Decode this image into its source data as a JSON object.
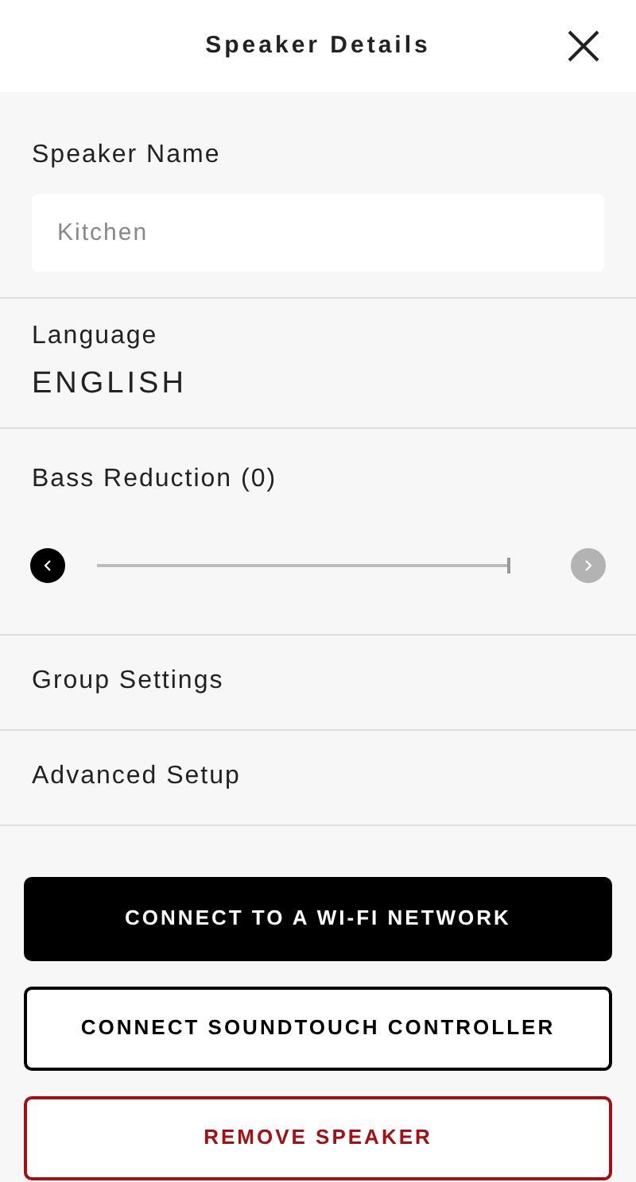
{
  "header": {
    "title": "Speaker Details"
  },
  "speaker_name": {
    "label": "Speaker Name",
    "placeholder": "Kitchen"
  },
  "language": {
    "label": "Language",
    "value": "ENGLISH"
  },
  "bass_reduction": {
    "label": "Bass Reduction (0)",
    "level": 1,
    "decrease_disabled": false,
    "increase_disabled": true
  },
  "menu_items": [
    {
      "label": "Group Settings"
    },
    {
      "label": "Advanced Setup"
    }
  ],
  "buttons": [
    {
      "label": "CONNECT TO A WI-FI NETWORK",
      "kind": "primary"
    },
    {
      "label": "CONNECT SOUNDTOUCH CONTROLLER",
      "kind": "secondary"
    },
    {
      "label": "REMOVE SPEAKER",
      "kind": "danger"
    }
  ]
}
